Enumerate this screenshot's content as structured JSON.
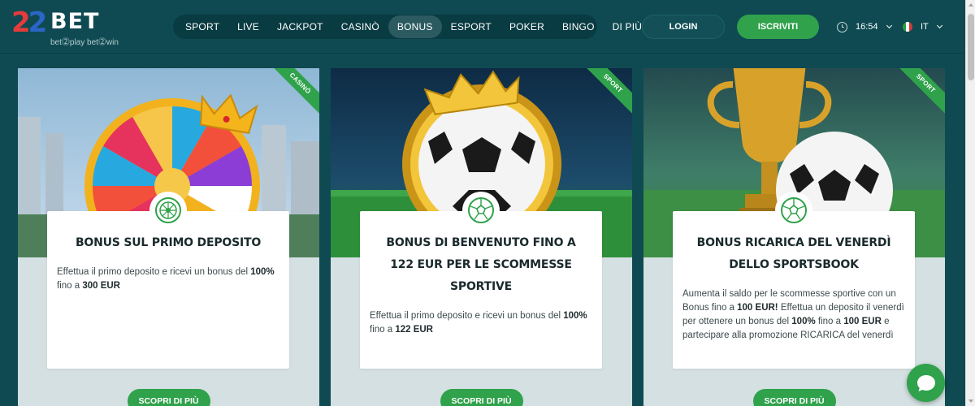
{
  "brand": {
    "logo_digits": "22",
    "logo_text": "BET",
    "tagline": "bet⓶play bet⓶win"
  },
  "nav": {
    "items": [
      "SPORT",
      "LIVE",
      "JACKPOT",
      "CASINÒ",
      "BONUS",
      "ESPORT",
      "POKER",
      "BINGO",
      "DI PIÙ"
    ],
    "active": "BONUS"
  },
  "header": {
    "login_label": "LOGIN",
    "register_label": "ISCRIVITI",
    "time": "16:54",
    "language": "IT"
  },
  "colors": {
    "background": "#0f4a52",
    "accent_green": "#2fa24b",
    "card_body": "#d4e0e1"
  },
  "cards": [
    {
      "ribbon": "CASINÒ",
      "icon": "roulette-icon",
      "title": "BONUS SUL PRIMO DEPOSITO",
      "desc_parts": [
        "Effettua il primo deposito e ricevi un bonus del ",
        "100%",
        " fino a ",
        "300 EUR",
        ""
      ],
      "cta": "SCOPRI DI PIÙ"
    },
    {
      "ribbon": "SPORT",
      "icon": "soccer-ball-icon",
      "title": "BONUS DI BENVENUTO FINO A 122 EUR PER LE SCOMMESSE SPORTIVE",
      "desc_parts": [
        "Effettua il primo deposito e ricevi un bonus del ",
        "100%",
        " fino a ",
        "122 EUR",
        ""
      ],
      "cta": "SCOPRI DI PIÙ"
    },
    {
      "ribbon": "SPORT",
      "icon": "soccer-ball-icon",
      "title": "BONUS RICARICA DEL VENERDÌ DELLO SPORTSBOOK",
      "desc_parts": [
        "Aumenta il saldo per le scommesse sportive con un Bonus fino a ",
        "100 EUR!",
        " Effettua un deposito il venerdì per ottenere un bonus del ",
        "100%",
        " fino a ",
        "100 EUR",
        " e partecipare alla promozione RICARICA del venerdì"
      ],
      "cta": "SCOPRI DI PIÙ"
    }
  ],
  "chat": {
    "icon": "chat-icon"
  }
}
